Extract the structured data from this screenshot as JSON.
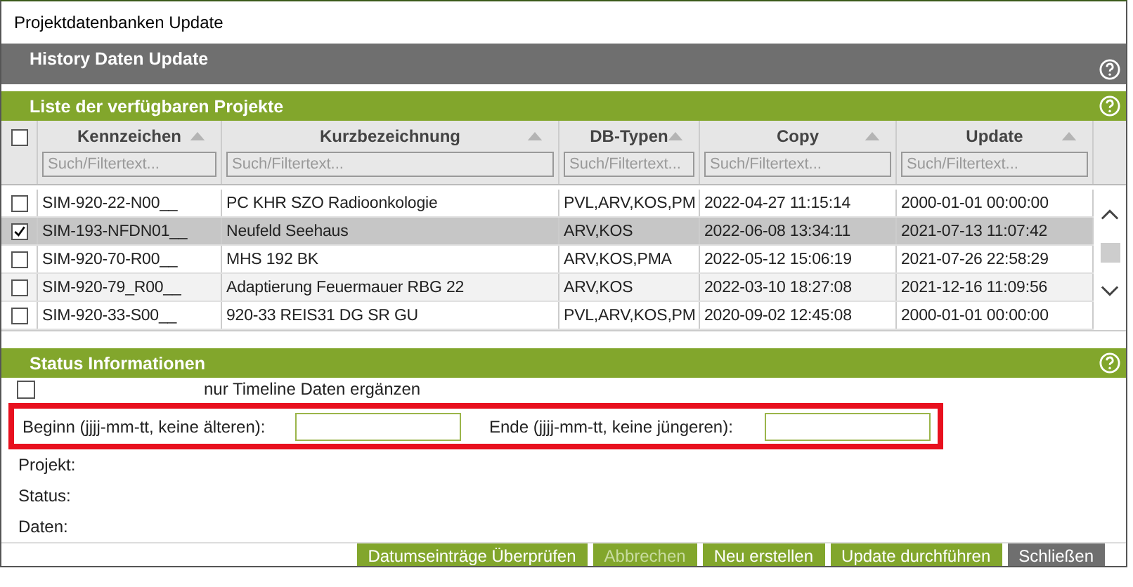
{
  "window": {
    "title": "Projektdatenbanken Update"
  },
  "header": {
    "title": "History Daten Update"
  },
  "projects": {
    "title": "Liste der verfügbaren Projekte",
    "all_checked": false,
    "columns": [
      {
        "label": "Kennzeichen",
        "placeholder": "Such/Filtertext..."
      },
      {
        "label": "Kurzbezeichnung",
        "placeholder": "Such/Filtertext..."
      },
      {
        "label": "DB-Typen",
        "placeholder": "Such/Filtertext..."
      },
      {
        "label": "Copy",
        "placeholder": "Such/Filtertext..."
      },
      {
        "label": "Update",
        "placeholder": "Such/Filtertext..."
      }
    ],
    "rows": [
      {
        "selected": false,
        "checked": false,
        "cells": [
          "SIM-920-22-N00__",
          "PC KHR SZO Radioonkologie",
          "PVL,ARV,KOS,PM",
          "2022-04-27 11:15:14",
          "2000-01-01 00:00:00"
        ]
      },
      {
        "selected": true,
        "checked": true,
        "cells": [
          "SIM-193-NFDN01__",
          "Neufeld Seehaus",
          "ARV,KOS",
          "2022-06-08 13:34:11",
          "2021-07-13 11:07:42"
        ]
      },
      {
        "selected": false,
        "checked": false,
        "cells": [
          "SIM-920-70-R00__",
          "MHS 192 BK",
          "ARV,KOS,PMA",
          "2022-05-12 15:06:19",
          "2021-07-26 22:58:29"
        ]
      },
      {
        "selected": false,
        "checked": false,
        "cells": [
          "SIM-920-79_R00__",
          "Adaptierung Feuermauer RBG 22",
          "ARV,KOS",
          "2022-03-10 18:27:08",
          "2021-12-16 11:09:56"
        ]
      },
      {
        "selected": false,
        "checked": false,
        "cells": [
          "SIM-920-33-S00__",
          "920-33 REIS31 DG SR GU",
          "PVL,ARV,KOS,PM",
          "2020-09-02 12:45:08",
          "2000-01-01 00:00:00"
        ]
      }
    ]
  },
  "status": {
    "title": "Status Informationen",
    "timeline": {
      "label": "nur Timeline Daten ergänzen",
      "checked": false
    },
    "begin_label": "Beginn (jjjj-mm-tt, keine älteren):",
    "end_label": "Ende (jjjj-mm-tt, keine jüngeren):",
    "info": [
      "Projekt:",
      "Status:",
      "Daten:"
    ]
  },
  "buttons": [
    {
      "label": "Datumseinträge Überprüfen",
      "kind": "primary",
      "disabled": false
    },
    {
      "label": "Abbrechen",
      "kind": "primary",
      "disabled": true
    },
    {
      "label": "Neu erstellen",
      "kind": "primary",
      "disabled": false
    },
    {
      "label": "Update durchführen",
      "kind": "primary",
      "disabled": false
    },
    {
      "label": "Schließen",
      "kind": "secondary",
      "disabled": false
    }
  ]
}
